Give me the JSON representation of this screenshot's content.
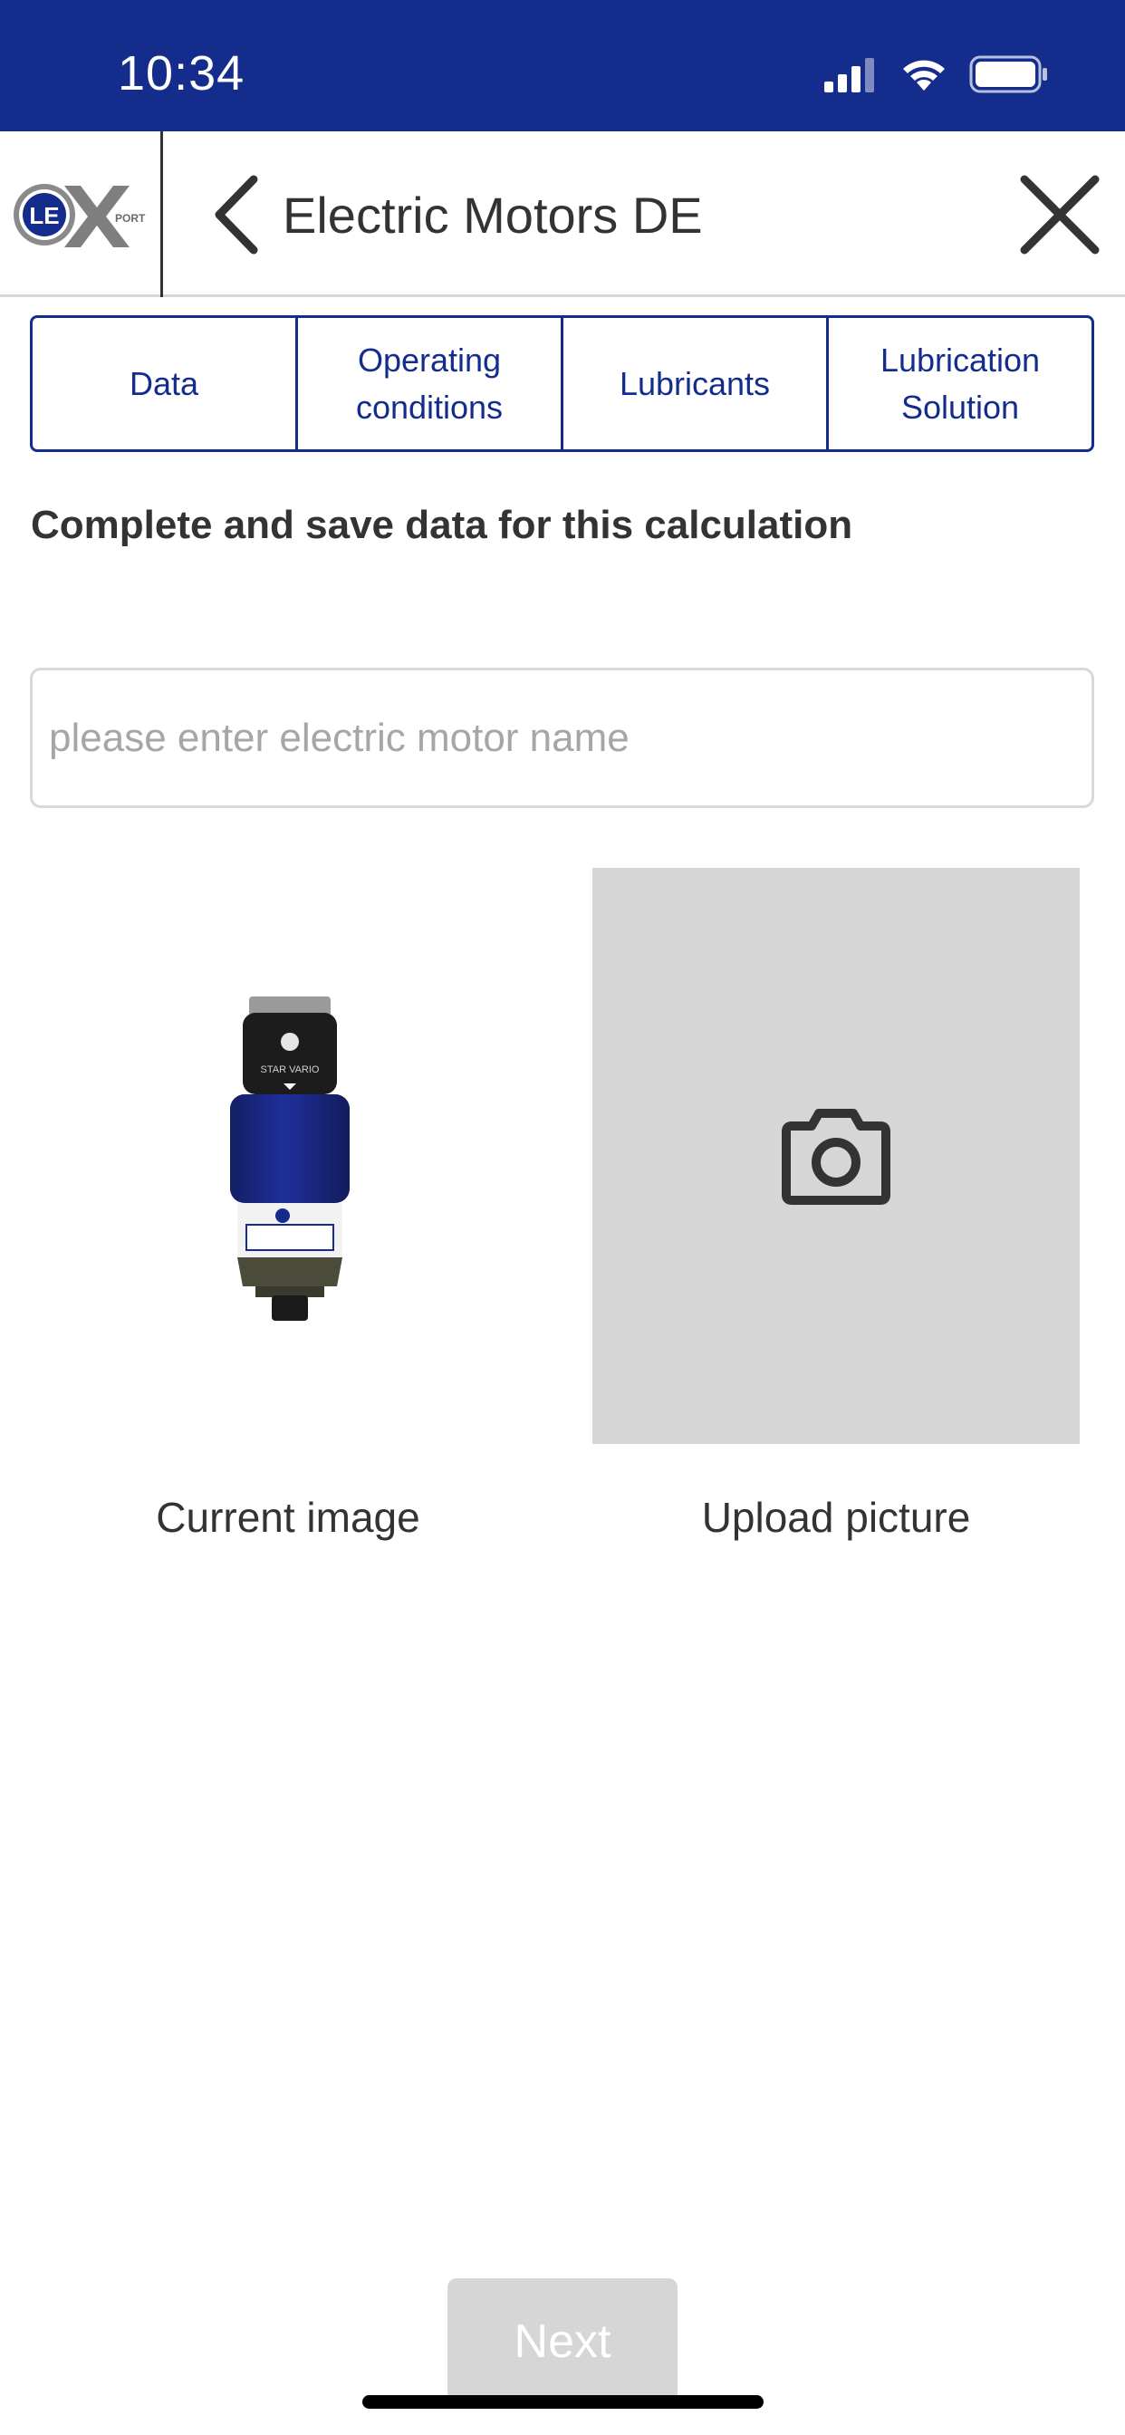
{
  "status_bar": {
    "time": "10:34"
  },
  "header": {
    "logo_text": "LE",
    "logo_sub": "PORT",
    "title": "Electric Motors DE",
    "back_icon": "chevron-left-icon",
    "close_icon": "close-icon"
  },
  "tabs": [
    {
      "label": "Data"
    },
    {
      "label": "Operating conditions"
    },
    {
      "label": "Lubricants"
    },
    {
      "label": "Lubrication Solution"
    }
  ],
  "main": {
    "heading": "Complete and save data for this calculation",
    "name_input": {
      "value": "",
      "placeholder": "please enter electric motor name"
    },
    "current_image_caption": "Current image",
    "product_label": "STAR VARIO",
    "upload_caption": "Upload picture",
    "upload_icon": "camera-icon"
  },
  "footer": {
    "next_label": "Next"
  },
  "colors": {
    "brand_blue": "#142d8c",
    "text": "#333333",
    "placeholder": "#a6a6a6",
    "disabled": "#d6d6d6"
  }
}
